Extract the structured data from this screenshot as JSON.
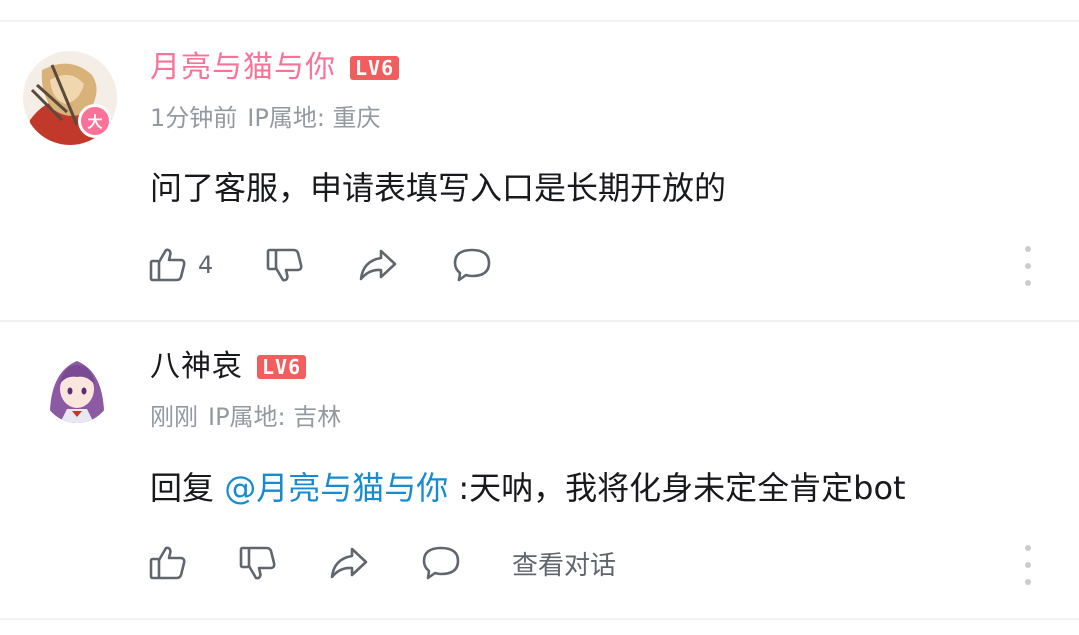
{
  "comments": [
    {
      "username": "月亮与猫与你",
      "level": "LV6",
      "avatar_badge": "大",
      "time": "1分钟前",
      "ip": "IP属地: 重庆",
      "content": "问了客服，申请表填写入口是长期开放的",
      "like_count": "4"
    },
    {
      "username": "八神哀",
      "level": "LV6",
      "time": "刚刚",
      "ip": "IP属地: 吉林",
      "reply_prefix": "回复 ",
      "mention": "@月亮与猫与你",
      "reply_text": " :天呐，我将化身未定全肯定bot",
      "view_conversation": "查看对话"
    }
  ],
  "colors": {
    "pink_username": "#fb7299",
    "level_badge": "#f25d5d",
    "mention": "#178bcf",
    "meta_gray": "#9499a0",
    "icon_gray": "#61666d"
  },
  "icons": [
    "thumbs-up-icon",
    "thumbs-down-icon",
    "share-icon",
    "comment-icon",
    "more-vertical-icon"
  ]
}
